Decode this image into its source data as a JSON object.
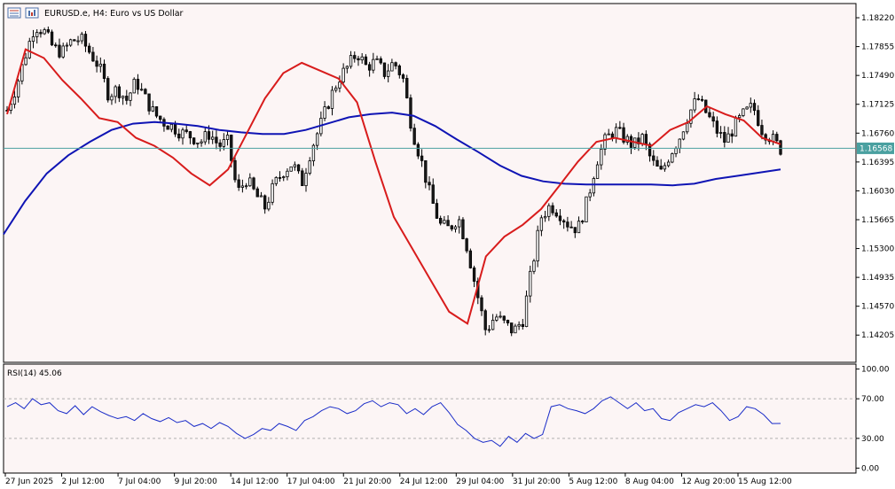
{
  "window": {
    "title": "EURUSD.e, H4:  Euro vs US Dollar",
    "icons": [
      "grid-icon",
      "chart-icon"
    ]
  },
  "colors": {
    "background": "#ffffff",
    "plot_background": "#fcf5f5",
    "bull_candle": "#ffffff",
    "bear_candle": "#1a1a1a",
    "wick": "#000000",
    "ma_fast": "#d81c1c",
    "ma_slow": "#0f14b4",
    "price_line": "#4aa0a0",
    "rsi_line": "#1a2cc8",
    "rsi_levels": "#b0b0b0",
    "price_tag_bg": "#4aa0a0",
    "price_tag_text": "#ffffff"
  },
  "chart_data": [
    {
      "type": "candlestick",
      "symbol": "EURUSD.e",
      "timeframe": "H4",
      "description": "Euro vs US Dollar",
      "ylim": [
        1.1395,
        1.1831
      ],
      "y_ticks": [
        "1.18220",
        "1.17855",
        "1.17490",
        "1.17125",
        "1.16760",
        "1.16395",
        "1.16030",
        "1.15665",
        "1.15300",
        "1.14935",
        "1.14570",
        "1.14205"
      ],
      "x_ticks": [
        "27 Jun 2025",
        "2 Jul 12:00",
        "7 Jul 04:00",
        "9 Jul 20:00",
        "14 Jul 12:00",
        "17 Jul 04:00",
        "21 Jul 20:00",
        "24 Jul 12:00",
        "29 Jul 04:00",
        "31 Jul 20:00",
        "5 Aug 12:00",
        "8 Aug 04:00",
        "12 Aug 20:00",
        "15 Aug 12:00"
      ],
      "current_price": "1.16568",
      "close_path": [
        1.1705,
        1.1735,
        1.1775,
        1.1812,
        1.1805,
        1.1784,
        1.1778,
        1.1793,
        1.1795,
        1.1778,
        1.176,
        1.1725,
        1.1732,
        1.1718,
        1.1742,
        1.172,
        1.17,
        1.169,
        1.1684,
        1.1676,
        1.1672,
        1.1665,
        1.1676,
        1.166,
        1.1665,
        1.16,
        1.1618,
        1.1598,
        1.1582,
        1.161,
        1.1628,
        1.1638,
        1.1612,
        1.1655,
        1.1685,
        1.1718,
        1.1745,
        1.176,
        1.1778,
        1.176,
        1.1766,
        1.1752,
        1.1766,
        1.1745,
        1.168,
        1.164,
        1.1595,
        1.156,
        1.1555,
        1.157,
        1.153,
        1.1475,
        1.1425,
        1.1445,
        1.1435,
        1.1425,
        1.144,
        1.1505,
        1.157,
        1.1585,
        1.1575,
        1.156,
        1.1555,
        1.159,
        1.164,
        1.1668,
        1.168,
        1.167,
        1.166,
        1.167,
        1.164,
        1.1625,
        1.165,
        1.167,
        1.17,
        1.172,
        1.17,
        1.168,
        1.1665,
        1.1685,
        1.17,
        1.171,
        1.168,
        1.167,
        1.1656
      ],
      "series": [
        {
          "values": [
            1.17,
            1.1782,
            1.1771,
            1.1743,
            1.172,
            1.1695,
            1.169,
            1.167,
            1.166,
            1.1645,
            1.1625,
            1.161,
            1.163,
            1.1675,
            1.172,
            1.1752,
            1.1765,
            1.1755,
            1.1745,
            1.1715,
            1.164,
            1.157,
            1.153,
            1.149,
            1.145,
            1.1435,
            1.152,
            1.1545,
            1.156,
            1.158,
            1.161,
            1.164,
            1.1665,
            1.167,
            1.1665,
            1.166,
            1.168,
            1.169,
            1.171,
            1.17,
            1.1692,
            1.167,
            1.1662
          ]
        },
        {
          "values": [
            1.1548,
            1.159,
            1.1625,
            1.1648,
            1.1665,
            1.168,
            1.1688,
            1.169,
            1.1688,
            1.1685,
            1.168,
            1.1677,
            1.1675,
            1.1675,
            1.168,
            1.1688,
            1.1696,
            1.17,
            1.1702,
            1.1698,
            1.1685,
            1.1668,
            1.1652,
            1.1635,
            1.1622,
            1.1615,
            1.1612,
            1.1611,
            1.1611,
            1.1611,
            1.1611,
            1.161,
            1.1612,
            1.1618,
            1.1622,
            1.1626,
            1.163
          ]
        }
      ]
    },
    {
      "type": "line",
      "label": "RSI(14) 45.06",
      "ylim": [
        -5,
        105
      ],
      "y_ticks": [
        "100.00",
        "70.00",
        "30.00",
        "0.00"
      ],
      "levels": [
        70,
        30
      ],
      "values": [
        62,
        66,
        60,
        70,
        64,
        66,
        58,
        55,
        63,
        54,
        62,
        57,
        53,
        50,
        52,
        48,
        55,
        50,
        47,
        51,
        46,
        48,
        42,
        45,
        40,
        46,
        42,
        35,
        30,
        34,
        40,
        38,
        45,
        42,
        38,
        48,
        52,
        58,
        62,
        60,
        55,
        58,
        65,
        68,
        62,
        66,
        64,
        55,
        60,
        54,
        62,
        66,
        56,
        44,
        38,
        30,
        26,
        28,
        22,
        32,
        26,
        35,
        30,
        34,
        62,
        64,
        60,
        58,
        55,
        60,
        68,
        72,
        66,
        60,
        66,
        58,
        60,
        50,
        48,
        56,
        60,
        64,
        62,
        66,
        58,
        48,
        52,
        62,
        60,
        54,
        45,
        45.06
      ]
    }
  ]
}
